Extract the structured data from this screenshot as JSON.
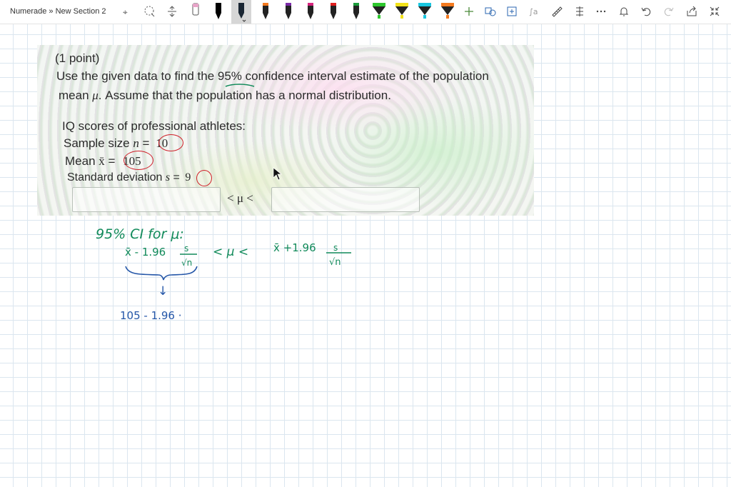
{
  "toolbar": {
    "breadcrumb": "Numerade » New Section 2",
    "tools": [
      {
        "name": "lasso-text-icon"
      },
      {
        "name": "lasso-select-icon"
      },
      {
        "name": "insert-space-icon"
      },
      {
        "name": "eraser-icon"
      },
      {
        "name": "pen-black-icon",
        "color": "#000000"
      },
      {
        "name": "pen-black-2-icon",
        "color": "#111111"
      },
      {
        "name": "pen-dark-active-icon",
        "color": "#1a2633"
      },
      {
        "name": "pen-orange-icon",
        "color": "#f47a1f"
      },
      {
        "name": "pen-purple-icon",
        "color": "#7b2aa8"
      },
      {
        "name": "pen-magenta-icon",
        "color": "#d6247e"
      },
      {
        "name": "pen-red-icon",
        "color": "#e02020"
      },
      {
        "name": "pen-green-icon",
        "color": "#1a9a3a"
      },
      {
        "name": "highlighter-green-icon",
        "color": "#2ec82e"
      },
      {
        "name": "highlighter-yellow-icon",
        "color": "#f2e21a"
      },
      {
        "name": "highlighter-cyan-icon",
        "color": "#1ac6e0"
      },
      {
        "name": "highlighter-orange-icon",
        "color": "#f47a1f"
      }
    ]
  },
  "problem": {
    "points": "(1 point)",
    "line1_a": "Use the given data to find the ",
    "line1_pct": "95%",
    "line1_b": " confidence interval estimate of the population",
    "line2_a": "mean ",
    "line2_mu": "μ",
    "line2_b": ". Assume that the population has a normal distribution.",
    "heading": "IQ scores of professional athletes:",
    "n_label": "Sample size ",
    "n_var": "n",
    "n_eq": " = ",
    "n_value": "10",
    "mean_label": "Mean ",
    "mean_var": "x̄",
    "mean_eq": " = ",
    "mean_value": "105",
    "sd_label": "Standard deviation ",
    "sd_var": "s",
    "sd_eq": " = ",
    "sd_value": "9",
    "interval_mid": "< μ <"
  },
  "handwriting": {
    "title": "95% CI for μ:",
    "left_term": "x̄ - 1.96",
    "frac_num": "s",
    "frac_den": "√n",
    "ineq": "< μ <",
    "right_term": "x̄ +1.96",
    "right_num": "s",
    "right_den": "√n",
    "arrow": "↓",
    "calc": "105 - 1.96 ·"
  },
  "colors": {
    "ink_green": "#118a5a",
    "ink_blue": "#2456a8",
    "circle_red": "#d0202a"
  }
}
